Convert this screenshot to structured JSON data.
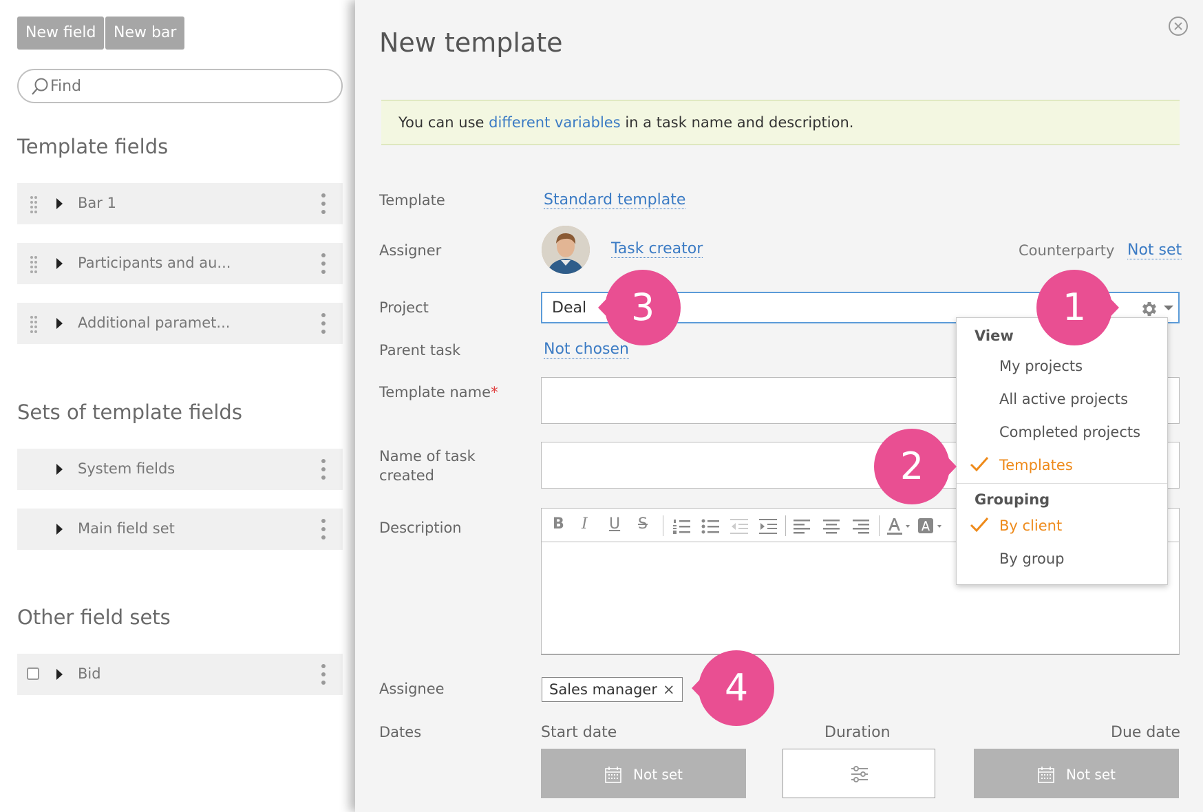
{
  "toolbar": {
    "new_field": "New field",
    "new_bar": "New bar"
  },
  "search": {
    "placeholder": "Find"
  },
  "left": {
    "template_fields_title": "Template fields",
    "template_fields": [
      "Bar 1",
      "Participants and au...",
      "Additional paramet..."
    ],
    "sets_title": "Sets of template fields",
    "sets": [
      "System fields",
      "Main field set"
    ],
    "other_title": "Other field sets",
    "other": [
      "Bid"
    ]
  },
  "panel": {
    "title": "New template",
    "notice_pre": "You can use ",
    "notice_link": "different variables",
    "notice_post": " in a task name and description.",
    "labels": {
      "template": "Template",
      "assigner": "Assigner",
      "project": "Project",
      "parent_task": "Parent task",
      "template_name": "Template name",
      "required_mark": "*",
      "name_of_task_1": "Name of task",
      "name_of_task_2": "created",
      "description": "Description",
      "assignee": "Assignee",
      "dates": "Dates",
      "counterparty": "Counterparty"
    },
    "template_value": "Standard template",
    "assigner_value": "Task creator",
    "counterparty_value": "Not set",
    "project_value": "Deal",
    "parent_task_value": "Not chosen",
    "assignee_tag": "Sales manager",
    "assignee_remove": "×",
    "dates": {
      "start": "Start date",
      "duration": "Duration",
      "due": "Due date",
      "start_value": "Not set",
      "due_value": "Not set"
    }
  },
  "dropdown": {
    "view_header": "View",
    "view_items": [
      "My projects",
      "All active projects",
      "Completed projects",
      "Templates"
    ],
    "view_selected": 3,
    "grouping_header": "Grouping",
    "grouping_items": [
      "By client",
      "By group"
    ],
    "grouping_selected": 0
  },
  "badges": [
    "1",
    "2",
    "3",
    "4"
  ],
  "colors": {
    "accent_pink": "#e94f92",
    "selected_orange": "#ee8a1a",
    "link_blue": "#3b7bc4",
    "notice_bg": "#f3f7e1"
  }
}
